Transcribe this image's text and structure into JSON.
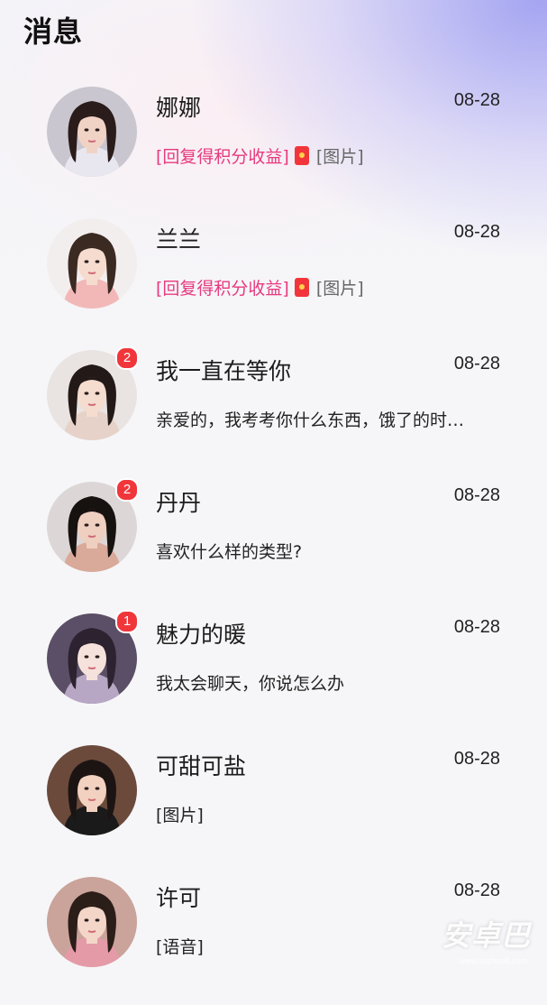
{
  "header": {
    "title": "消息"
  },
  "conversations": [
    {
      "name": "娜娜",
      "time": "08-28",
      "preview_tag": "[回复得积分收益]",
      "preview_text": "[图片]",
      "badge": "",
      "avatar": {
        "skin": "#f1d3c6",
        "hair": "#2a1c1a",
        "bg": "#c9c6cf",
        "shirt": "#e8e6ef"
      }
    },
    {
      "name": "兰兰",
      "time": "08-28",
      "preview_tag": "[回复得积分收益]",
      "preview_text": "[图片]",
      "badge": "",
      "avatar": {
        "skin": "#f6dccf",
        "hair": "#3a2a22",
        "bg": "#f3eeee",
        "shirt": "#f2b8b8"
      }
    },
    {
      "name": "我一直在等你",
      "time": "08-28",
      "preview_tag": "",
      "preview_text": "亲爱的，我考考你什么东西，饿了的时…",
      "badge": "2",
      "avatar": {
        "skin": "#f4dccf",
        "hair": "#231a18",
        "bg": "#e9e4e2",
        "shirt": "#e6d2c8"
      }
    },
    {
      "name": "丹丹",
      "time": "08-28",
      "preview_tag": "",
      "preview_text": "喜欢什么样的类型?",
      "badge": "2",
      "avatar": {
        "skin": "#efcfc0",
        "hair": "#161210",
        "bg": "#dcd7d6",
        "shirt": "#d9a99a"
      }
    },
    {
      "name": "魅力的暖",
      "time": "08-28",
      "preview_tag": "",
      "preview_text": "我太会聊天，你说怎么办",
      "badge": "1",
      "avatar": {
        "skin": "#f6e2dc",
        "hair": "#2c2230",
        "bg": "#5a4f66",
        "shirt": "#b8a7c4"
      }
    },
    {
      "name": "可甜可盐",
      "time": "08-28",
      "preview_tag": "",
      "preview_text": "[图片]",
      "badge": "",
      "avatar": {
        "skin": "#f2d1c0",
        "hair": "#1c1412",
        "bg": "#6b4a3c",
        "shirt": "#1a1a1a"
      }
    },
    {
      "name": "许可",
      "time": "08-28",
      "preview_tag": "",
      "preview_text": "[语音]",
      "badge": "",
      "avatar": {
        "skin": "#f3d6c8",
        "hair": "#2b1d18",
        "bg": "#caa39a",
        "shirt": "#e59aa8"
      }
    }
  ],
  "watermark": {
    "text": "安卓巴",
    "sub": "www.anzhuo8.com"
  },
  "colors": {
    "promo": "#e8397f",
    "badge": "#f0363b"
  }
}
